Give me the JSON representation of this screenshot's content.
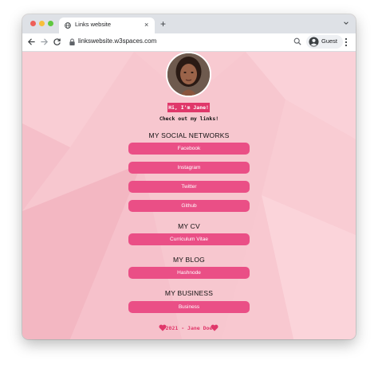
{
  "browser": {
    "tab_title": "Links website",
    "tab_close_glyph": "×",
    "new_tab_glyph": "+",
    "url": "linkswebsite.w3spaces.com",
    "profile_label": "Guest",
    "icons": [
      "globe-icon",
      "chevron-down-icon",
      "back-arrow-icon",
      "forward-arrow-icon",
      "reload-icon",
      "lock-icon",
      "search-icon",
      "profile-icon",
      "kebab-menu-icon"
    ]
  },
  "page": {
    "greeting": "Hi, I'm Jane!",
    "tagline": "Check out my links!",
    "sections": [
      {
        "heading": "MY SOCIAL NETWORKS",
        "links": [
          "Facebook",
          "Instagram",
          "Twitter",
          "Github"
        ]
      },
      {
        "heading": "MY CV",
        "links": [
          "Curriculum Vitae"
        ]
      },
      {
        "heading": "MY BLOG",
        "links": [
          "Hashnode"
        ]
      },
      {
        "heading": "MY BUSINESS",
        "links": [
          "Business"
        ]
      }
    ],
    "footer": "2021 - Jane Doe"
  },
  "colors": {
    "page_background": "#f7c7cf",
    "accent": "#e0376a",
    "button": "#ea4f86",
    "button_text": "#ffffff"
  }
}
